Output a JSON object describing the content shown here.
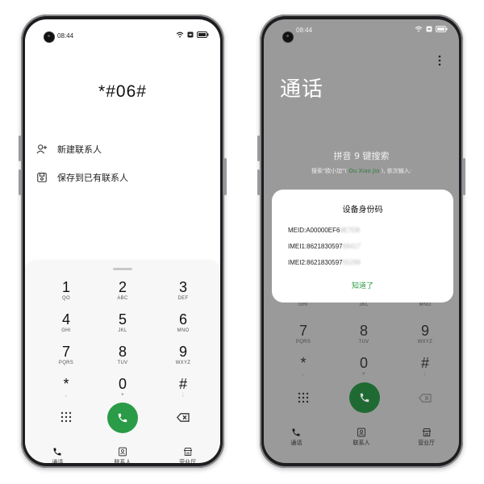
{
  "status": {
    "time": "08:44"
  },
  "left_phone": {
    "dialed_code": "*#06#",
    "actions": [
      {
        "label": "新建联系人",
        "icon": "add-contact-icon"
      },
      {
        "label": "保存到已有联系人",
        "icon": "save-contact-icon"
      }
    ]
  },
  "keypad": [
    {
      "digit": "1",
      "letters": "QO"
    },
    {
      "digit": "2",
      "letters": "ABC"
    },
    {
      "digit": "3",
      "letters": "DEF"
    },
    {
      "digit": "4",
      "letters": "GHI"
    },
    {
      "digit": "5",
      "letters": "JKL"
    },
    {
      "digit": "6",
      "letters": "MNO"
    },
    {
      "digit": "7",
      "letters": "PQRS"
    },
    {
      "digit": "8",
      "letters": "TUV"
    },
    {
      "digit": "9",
      "letters": "WXYZ"
    },
    {
      "digit": "*",
      "letters": ","
    },
    {
      "digit": "0",
      "letters": "+"
    },
    {
      "digit": "#",
      "letters": ";"
    }
  ],
  "nav": [
    {
      "label": "通话",
      "icon": "phone-icon"
    },
    {
      "label": "联系人",
      "icon": "contacts-icon"
    },
    {
      "label": "营业厅",
      "icon": "store-icon"
    }
  ],
  "right_phone": {
    "title": "通话",
    "search_title": "拼音 9 键搜索",
    "search_hint_before": "搜索\"欧小加\"(",
    "search_hint_green": " Ou Xiao Jia ",
    "search_hint_after": "), 依次输入:",
    "dialog": {
      "title": "设备身份码",
      "lines": [
        {
          "visible": "MEID:A00000EF6",
          "obscured": "9E7D8"
        },
        {
          "visible": "IMEI1:8621830597",
          "obscured": "69417"
        },
        {
          "visible": "IMEI2:8621830597",
          "obscured": "55299"
        }
      ],
      "ok_label": "知道了"
    }
  },
  "colors": {
    "accent_green": "#2a9b46",
    "dim_overlay": "#9a9a9a"
  }
}
